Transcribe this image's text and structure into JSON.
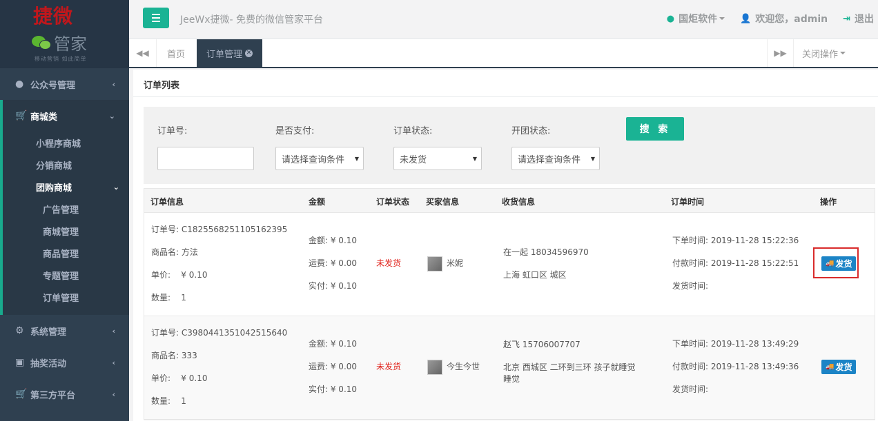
{
  "brand": {
    "title": "捷微",
    "name": "管家",
    "slogan": "移动营销 如此简单"
  },
  "sidebar": {
    "items": [
      {
        "label": "公众号管理"
      },
      {
        "label": "商城类"
      },
      {
        "label": "系统管理"
      },
      {
        "label": "抽奖活动"
      },
      {
        "label": "第三方平台"
      }
    ],
    "mall_sub": [
      "小程序商城",
      "分销商城",
      "团购商城"
    ],
    "group_sub": [
      "广告管理",
      "商城管理",
      "商品管理",
      "专题管理",
      "订单管理"
    ]
  },
  "topbar": {
    "title": "JeeWx捷微- 免费的微信管家平台",
    "software": "国炬软件",
    "welcome": "欢迎您，admin",
    "logout": "退出"
  },
  "tabs": {
    "home": "首页",
    "active": "订单管理",
    "close_ops": "关闭操作"
  },
  "page": {
    "title": "订单列表"
  },
  "search": {
    "order_no_label": "订单号:",
    "order_no_value": "",
    "paid_label": "是否支付:",
    "paid_value": "请选择查询条件",
    "status_label": "订单状态:",
    "status_value": "未发货",
    "group_label": "开团状态:",
    "group_value": "请选择查询条件",
    "button": "搜 索"
  },
  "table": {
    "headers": [
      "订单信息",
      "金额",
      "订单状态",
      "买家信息",
      "收货信息",
      "订单时间",
      "操作"
    ],
    "rows": [
      {
        "order_no": "订单号: C1825568251105162395",
        "product": "商品名: 方法",
        "price": "单价:    ¥ 0.10",
        "qty": "数量:    1",
        "amount": "金额: ¥ 0.10",
        "freight": "运费: ¥ 0.00",
        "actual": "实付: ¥ 0.10",
        "status": "未发货",
        "buyer": "米妮",
        "receiver": "在一起  18034596970",
        "address": "上海 虹口区 城区",
        "order_time": "下单时间: 2019-11-28 15:22:36",
        "pay_time": "付款时间: 2019-11-28 15:22:51",
        "ship_time": "发货时间:",
        "action": "发货"
      },
      {
        "order_no": "订单号: C3980441351042515640",
        "product": "商品名: 333",
        "price": "单价:    ¥ 0.10",
        "qty": "数量:    1",
        "amount": "金额: ¥ 0.10",
        "freight": "运费: ¥ 0.00",
        "actual": "实付: ¥ 0.10",
        "status": "未发货",
        "buyer": "今生今世",
        "receiver": "赵飞  15706007707",
        "address": "北京 西城区 二环到三环 孩子就睡觉睡觉",
        "order_time": "下单时间: 2019-11-28 13:49:29",
        "pay_time": "付款时间: 2019-11-28 13:49:36",
        "ship_time": "发货时间:",
        "action": "发货"
      }
    ]
  },
  "colors": {
    "accent": "#1ab394",
    "sidebar": "#2f4050",
    "ship_button": "#1c84c6",
    "status_red": "#e0221b"
  }
}
